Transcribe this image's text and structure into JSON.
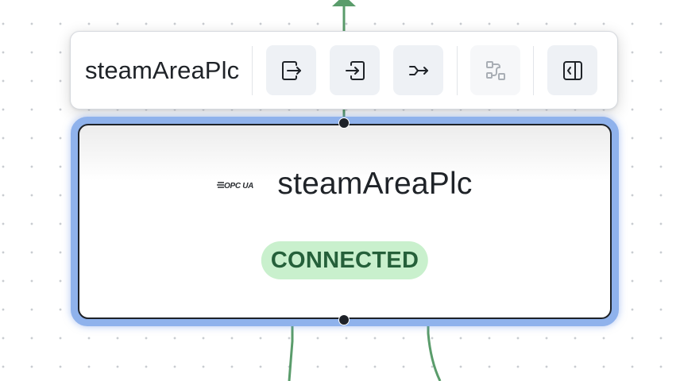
{
  "toolbar": {
    "title": "steamAreaPlc",
    "buttons": [
      {
        "name": "output-port-button",
        "icon": "arrow-right-from-box-icon",
        "enabled": true
      },
      {
        "name": "input-port-button",
        "icon": "arrow-right-into-box-icon",
        "enabled": true
      },
      {
        "name": "route-button",
        "icon": "merge-arrow-icon",
        "enabled": true
      },
      {
        "name": "variable-link-button",
        "icon": "route-squares-icon",
        "enabled": false
      },
      {
        "name": "panel-toggle-button",
        "icon": "sidebar-left-icon",
        "enabled": true
      }
    ]
  },
  "node": {
    "protocol_logo": "OPC UA",
    "title": "steamAreaPlc",
    "status": "CONNECTED"
  },
  "colors": {
    "edge": "#5a9c6b",
    "selection": "#8fb2ec",
    "status_bg": "#c9f0cd",
    "status_text": "#25603a",
    "button_bg": "#eef1f5"
  }
}
